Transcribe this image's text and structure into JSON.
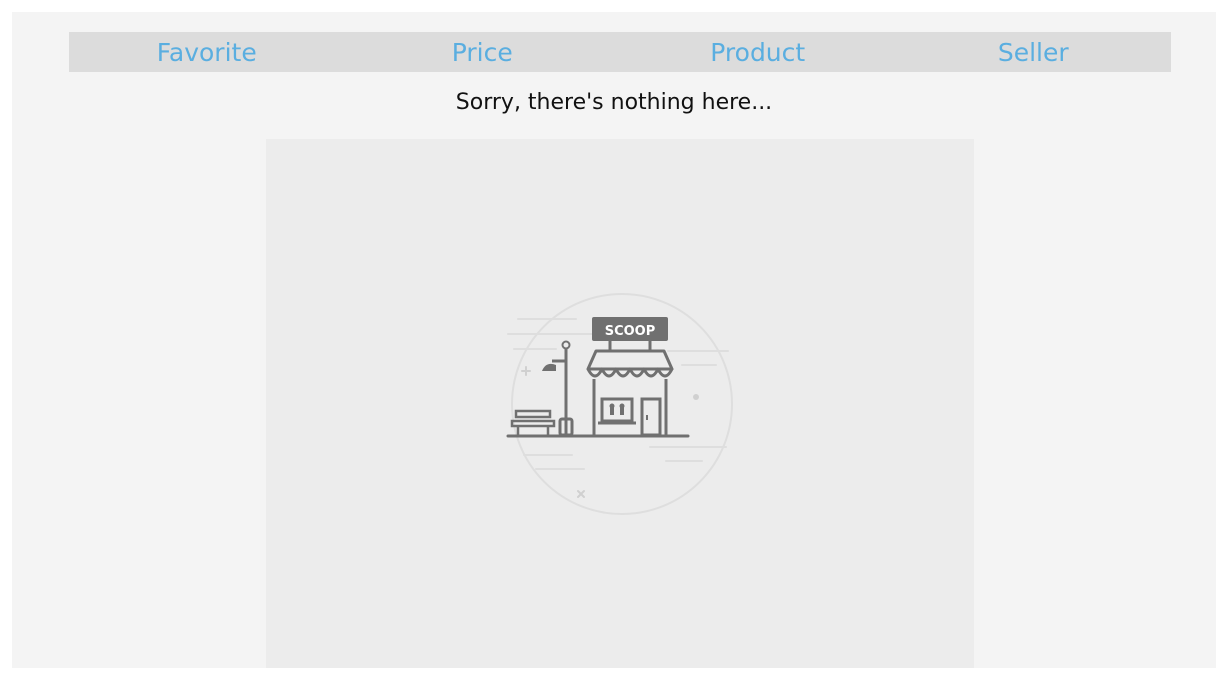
{
  "tabs": [
    {
      "label": "Favorite"
    },
    {
      "label": "Price"
    },
    {
      "label": "Product"
    },
    {
      "label": "Seller"
    }
  ],
  "empty_state": {
    "message": "Sorry, there's nothing here...",
    "sign_text": "SCOOP"
  },
  "colors": {
    "tab_text": "#5aaee0",
    "tabbar_bg": "#dcdcdc",
    "panel_bg": "#f4f4f4",
    "illustration_bg": "#ececec"
  }
}
